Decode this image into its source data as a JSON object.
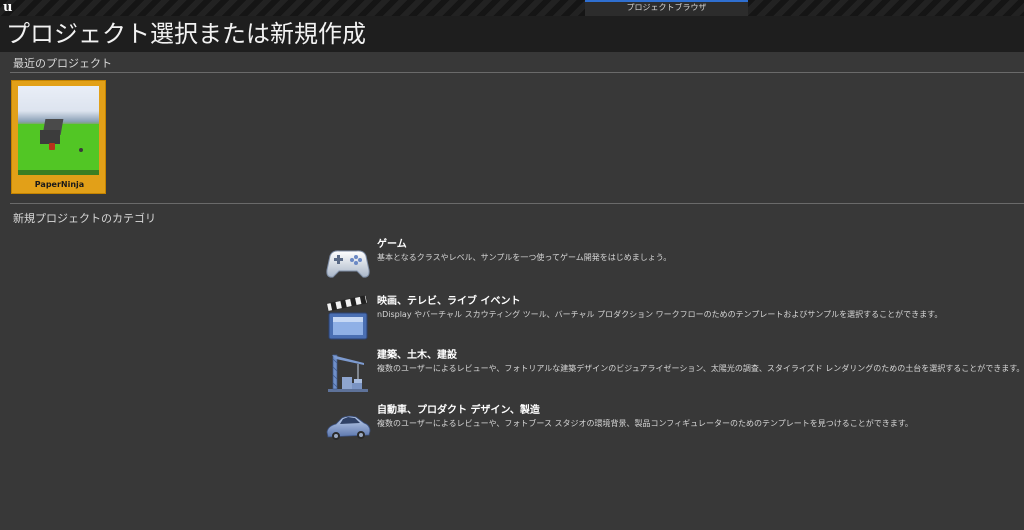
{
  "window": {
    "title": "プロジェクトブラウザ",
    "logo": "u"
  },
  "header": {
    "title": "プロジェクト選択または新規作成"
  },
  "recent": {
    "label": "最近のプロジェクト",
    "projects": [
      {
        "name": "PaperNinja"
      }
    ]
  },
  "new_project": {
    "label": "新規プロジェクトのカテゴリ",
    "categories": [
      {
        "icon": "gamepad-icon",
        "title": "ゲーム",
        "description": "基本となるクラスやレベル、サンプルを一つ使ってゲーム開発をはじめましょう。"
      },
      {
        "icon": "clapperboard-icon",
        "title": "映画、テレビ、ライブ イベント",
        "description": "nDisplay やバーチャル スカウティング ツール、バーチャル プロダクション ワークフローのためのテンプレートおよびサンプルを選択することができます。"
      },
      {
        "icon": "crane-icon",
        "title": "建築、土木、建設",
        "description": "複数のユーザーによるレビューや、フォトリアルな建築デザインのビジュアライゼーション、太陽光の調査、スタイライズド レンダリングのための土台を選択することができます。"
      },
      {
        "icon": "car-icon",
        "title": "自動車、プロダクト デザイン、製造",
        "description": "複数のユーザーによるレビューや、フォトブース スタジオの環境背景、製品コンフィギュレーターのためのテンプレートを見つけることができます。"
      }
    ]
  },
  "colors": {
    "selection": "#e2a018",
    "background": "#383838",
    "header": "#1e1e1e",
    "tab_accent": "#2f6fd0"
  }
}
